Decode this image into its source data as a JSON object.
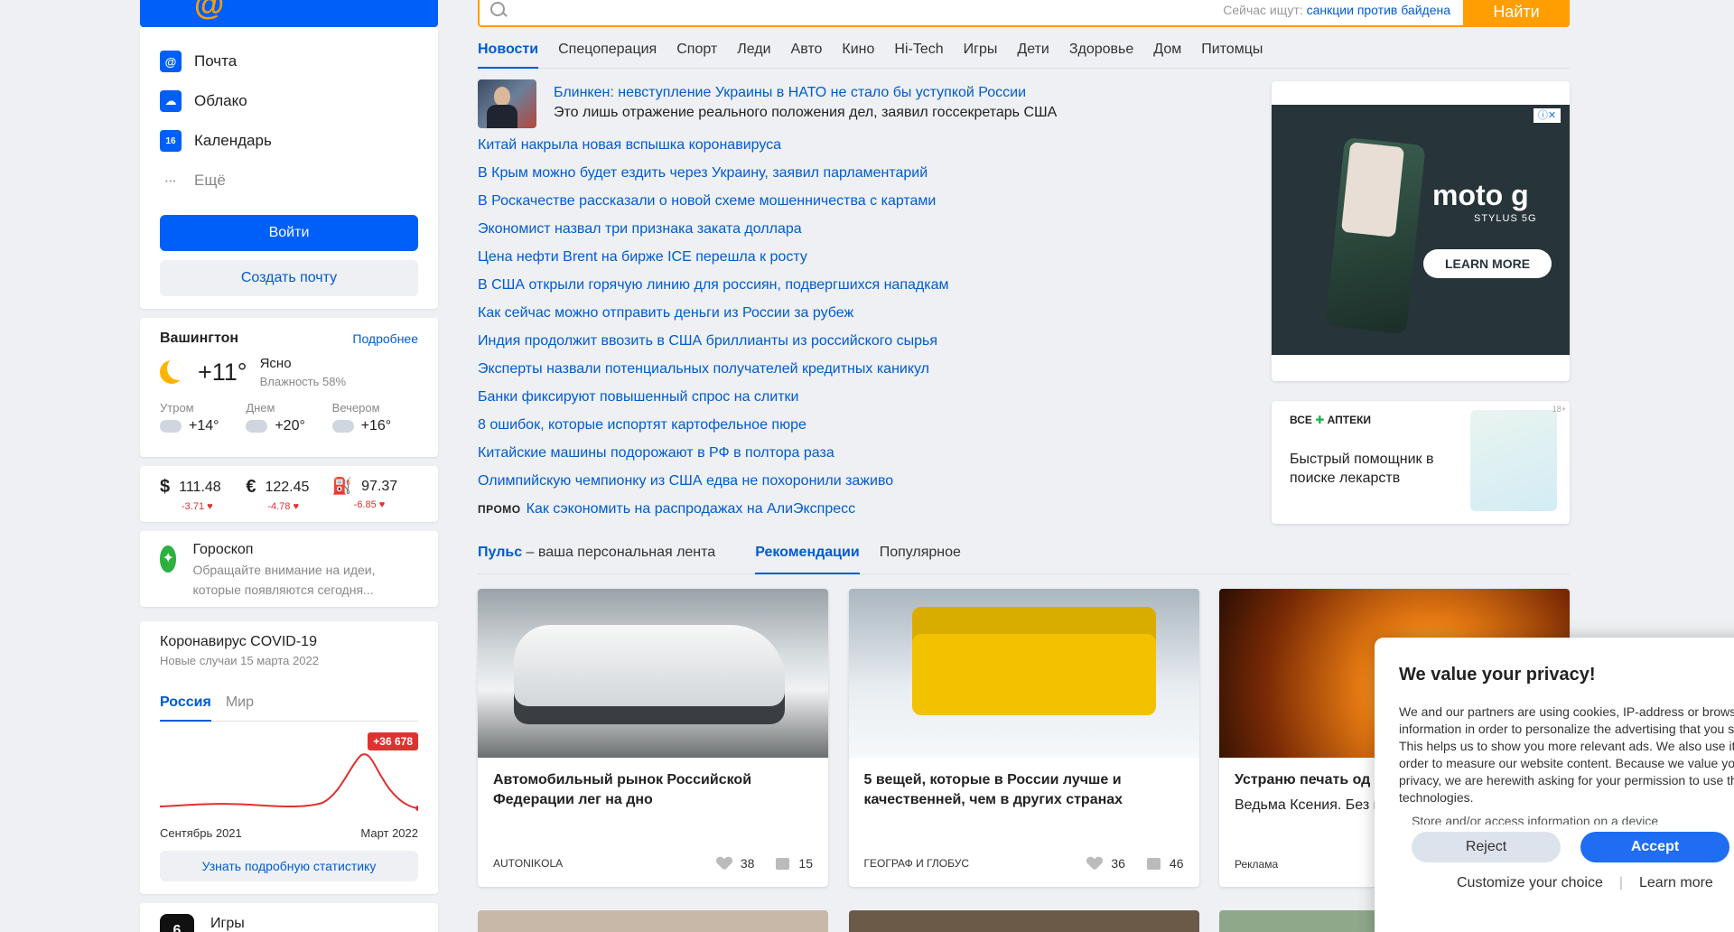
{
  "search": {
    "hint_label": "Сейчас ищут:",
    "hint_query": "санкции против байдена",
    "button": "Найти"
  },
  "services": [
    {
      "label": "Почта",
      "icon": "mail-icon",
      "color": "#005ff9"
    },
    {
      "label": "Облако",
      "icon": "cloud-icon",
      "color": "#005ff9"
    },
    {
      "label": "Календарь",
      "icon": "calendar-icon",
      "color": "#005ff9"
    },
    {
      "label": "Ещё",
      "icon": "more-icon",
      "color": "#999999"
    }
  ],
  "auth": {
    "login": "Войти",
    "create_mail": "Создать почту"
  },
  "weather": {
    "city": "Вашингтон",
    "more": "Подробнее",
    "temp": "+11°",
    "condition": "Ясно",
    "humidity": "Влажность 58%",
    "parts": [
      {
        "label": "Утром",
        "temp": "+14°"
      },
      {
        "label": "Днем",
        "temp": "+20°"
      },
      {
        "label": "Вечером",
        "temp": "+16°"
      }
    ]
  },
  "rates": [
    {
      "symbol": "$",
      "value": "111.48",
      "change": "-3.71"
    },
    {
      "symbol": "€",
      "value": "122.45",
      "change": "-4.78"
    },
    {
      "symbol": "oil",
      "value": "97.37",
      "change": "-6.85"
    }
  ],
  "horoscope": {
    "title": "Гороскоп",
    "text": "Обращайте внимание на идеи, которые появляются сегодня..."
  },
  "covid": {
    "title": "Коронавирус COVID-19",
    "subtitle": "Новые случаи 15 марта 2022",
    "tabs": [
      "Россия",
      "Мир"
    ],
    "badge": "+36 678",
    "axis_start": "Сентябрь 2021",
    "axis_end": "Март 2022",
    "button": "Узнать подробную статистику"
  },
  "games": {
    "title": "Игры"
  },
  "news_tabs": [
    "Новости",
    "Спецоперация",
    "Спорт",
    "Леди",
    "Авто",
    "Кино",
    "Hi-Tech",
    "Игры",
    "Дети",
    "Здоровье",
    "Дом",
    "Питомцы"
  ],
  "headline": {
    "title": "Блинкен: невступление Украины в НАТО не стало бы уступкой России",
    "subtitle": "Это лишь отражение реального положения дел, заявил госсекретарь США"
  },
  "news": [
    "Китай накрыла новая вспышка коронавируса",
    "В Крым можно будет ездить через Украину, заявил парламентарий",
    "В Роскачестве рассказали о новой схеме мошенничества с картами",
    "Экономист назвал три признака заката доллара",
    "Цена нефти Brent на бирже ICE перешла к росту",
    "В США открыли горячую линию для россиян, подвергшихся нападкам",
    "Как сейчас можно отправить деньги из России за рубеж",
    "Индия продолжит ввозить в США бриллианты из российского сырья",
    "Эксперты назвали потенциальных получателей кредитных каникул",
    "Банки фиксируют повышенный спрос на слитки",
    "8 ошибок, которые испортят картофельное пюре",
    "Китайские машины подорожают в РФ в полтора раза",
    "Олимпийскую чемпионку из США едва не похоронили заживо"
  ],
  "promo": {
    "label": "ПРОМО",
    "text": "Как сэкономить на распродажах на АлиЭкспресс"
  },
  "ad1": {
    "brand": "moto g",
    "sub": "STYLUS 5G",
    "cta": "LEARN MORE"
  },
  "ad2": {
    "logo_a": "ВСЕ",
    "logo_b": "АПТЕКИ",
    "text": "Быстрый помощник в поиске лекарств",
    "age": "18+"
  },
  "feed": {
    "pulse": "Пульс",
    "pulse_rest": " – ваша персональная лента",
    "tabs": [
      "Рекомендации",
      "Популярное"
    ]
  },
  "cards": [
    {
      "title": "Автомобильный рынок Российской Федерации лег на дно",
      "desc": "",
      "source": "AUTONIKOLA",
      "likes": "38",
      "comments": "15"
    },
    {
      "title": "5 вещей, которые в России лучше и качественней, чем в других странах",
      "desc": "",
      "source": "ГЕОГРАФ И ГЛОБУС",
      "likes": "36",
      "comments": "46"
    },
    {
      "title": "Устраню печать од",
      "desc": "Ведьма Ксения. Без магия. Результат за",
      "source": "Реклама",
      "likes": "",
      "comments": ""
    }
  ],
  "privacy": {
    "title": "We value your privacy!",
    "body": "We and our partners are using cookies, IP-address or browser information in order to personalize the advertising that you see. This helps us to show you more relevant ads. We also use it in order to measure our website content. Because we value your privacy, we are herewith asking for your permission to use these technologies.",
    "more": "Store and/or access information on a device",
    "reject": "Reject",
    "accept": "Accept",
    "customize": "Customize your choice",
    "learn": "Learn more"
  }
}
